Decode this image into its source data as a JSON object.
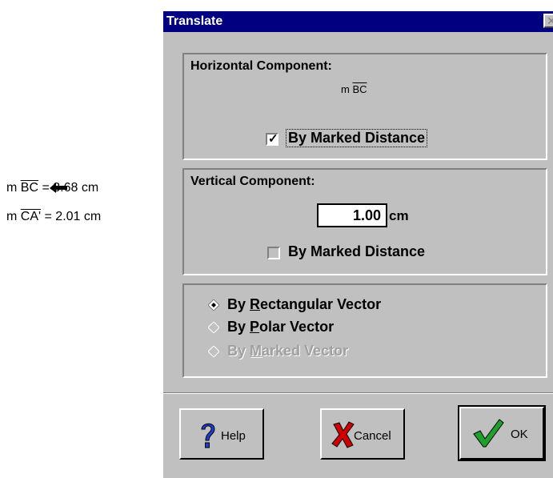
{
  "measurements": [
    {
      "prefix": "m ",
      "segment": "BC",
      "suffix": " = 3.68 cm"
    },
    {
      "prefix": "m ",
      "segment": "CA'",
      "suffix": " = 2.01 cm"
    }
  ],
  "dialog": {
    "title": "Translate",
    "close_glyph": "✕",
    "horizontal": {
      "title": "Horizontal Component:",
      "measure_prefix": "m ",
      "measure_segment": "BC",
      "checkbox_label": "By Marked Distance",
      "checked": true
    },
    "vertical": {
      "title": "Vertical Component:",
      "value": "1.00",
      "unit": "cm",
      "checkbox_label": "By Marked Distance",
      "checked": false
    },
    "vector_options": [
      {
        "pre": "By ",
        "key": "R",
        "post": "ectangular Vector",
        "selected": true,
        "enabled": true
      },
      {
        "pre": "By ",
        "key": "P",
        "post": "olar Vector",
        "selected": false,
        "enabled": true
      },
      {
        "pre": "By ",
        "key": "M",
        "post": "arked Vector",
        "selected": false,
        "enabled": false
      }
    ],
    "buttons": {
      "help": "Help",
      "cancel": "Cancel",
      "ok": "OK"
    }
  },
  "colors": {
    "titlebar": "#000080",
    "face": "#c0c0c0",
    "help_icon": "#1a3fd6",
    "cancel_icon": "#d00000",
    "ok_icon": "#1fa02a"
  }
}
